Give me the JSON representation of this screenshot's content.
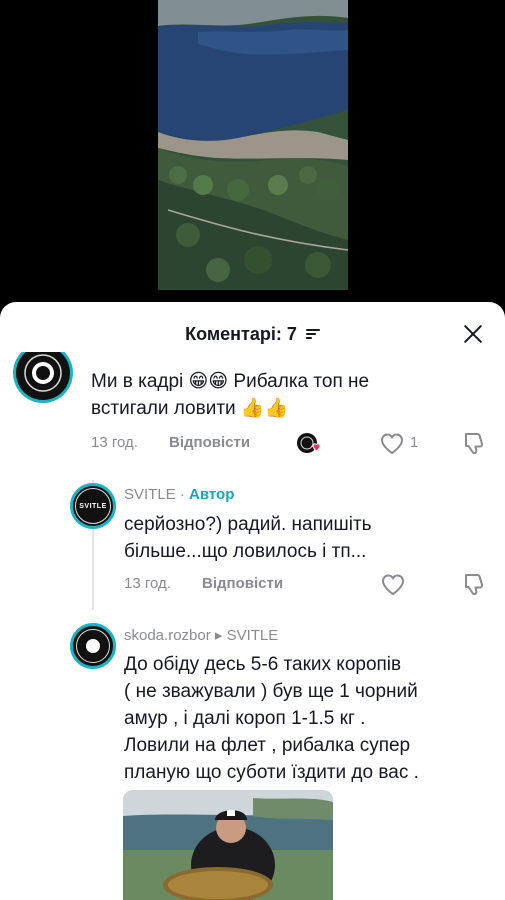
{
  "sheet": {
    "title": "Коментарі: 7"
  },
  "comments": [
    {
      "text": "Ми в кадрі 😁😁 Рибалка топ не встигали ловити 👍👍",
      "line1": "Ми в кадрі 😁😁 Рибалка топ не",
      "line2": "встигали ловити 👍👍",
      "time": "13 год.",
      "reply_label": "Відповісти",
      "likes": "1"
    }
  ],
  "reply1": {
    "username": "SVITLE",
    "separator": " · ",
    "author_label": "Автор",
    "line1": "серйозно?) радий. напишіть",
    "line2": "більше...що ловилось і тп...",
    "time": "13 год.",
    "reply_label": "Відповісти"
  },
  "reply2": {
    "username": "skoda.rozbor",
    "arrow": " ▸ ",
    "reply_to": "SVITLE",
    "lines": [
      "До обіду десь 5-6 таких коропів",
      "( не зважували ) був ще 1 чорний",
      "амур , і далі короп 1-1.5 кг .",
      "Ловили на флет , рибалка супер",
      "планую що суботи їздити до вас ."
    ]
  },
  "icons": {
    "close": "close-icon",
    "sort": "sort-icon",
    "heart": "heart-icon",
    "dislike": "dislike-icon"
  },
  "colors": {
    "accent": "#19b3c2",
    "author": "#19a7b8",
    "muted": "#8a8b91",
    "text": "#161823"
  }
}
